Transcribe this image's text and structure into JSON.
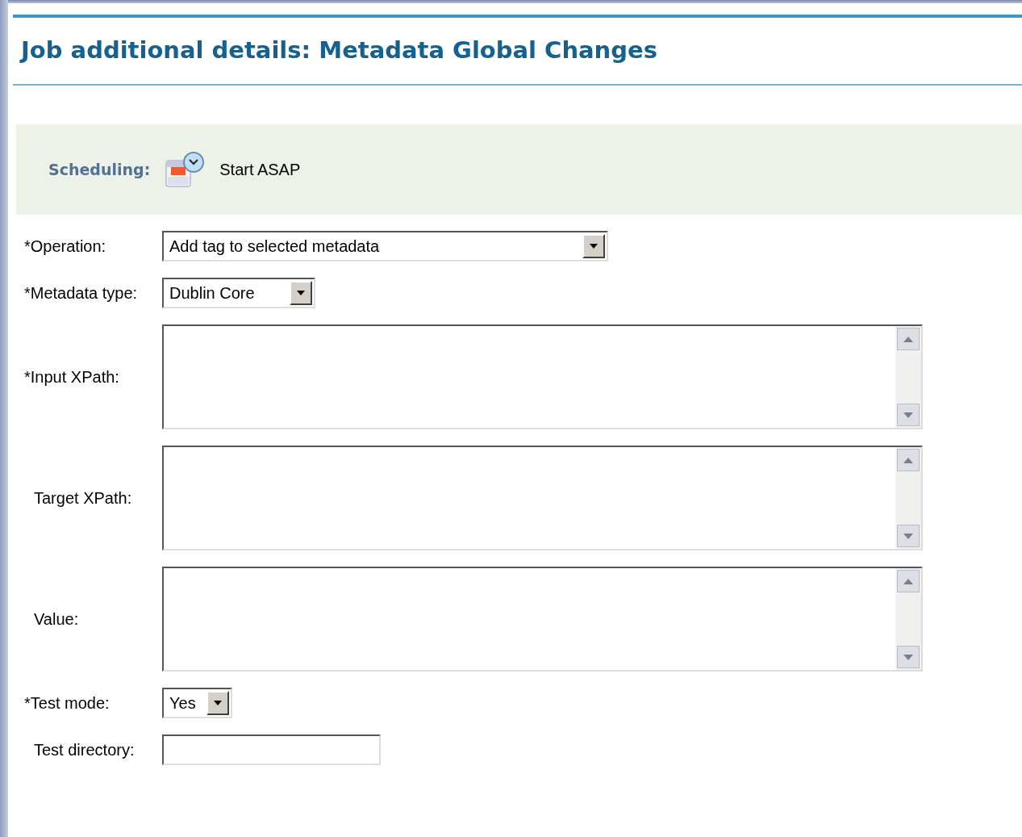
{
  "title": "Job additional details: Metadata Global Changes",
  "scheduling": {
    "label": "Scheduling:",
    "value": "Start ASAP"
  },
  "fields": [
    {
      "kind": "select",
      "label": "*Operation:",
      "required": true,
      "value": "Add tag to selected metadata"
    },
    {
      "kind": "select",
      "label": "*Metadata type:",
      "required": true,
      "value": "Dublin Core"
    },
    {
      "kind": "textarea",
      "label": "*Input XPath:",
      "required": true
    },
    {
      "kind": "textarea",
      "label": "Target XPath:",
      "required": false
    },
    {
      "kind": "textarea",
      "label": "Value:",
      "required": false
    },
    {
      "kind": "select",
      "label": "*Test mode:",
      "required": true,
      "value": "Yes"
    },
    {
      "kind": "text",
      "label": "Test directory:",
      "required": false
    }
  ]
}
